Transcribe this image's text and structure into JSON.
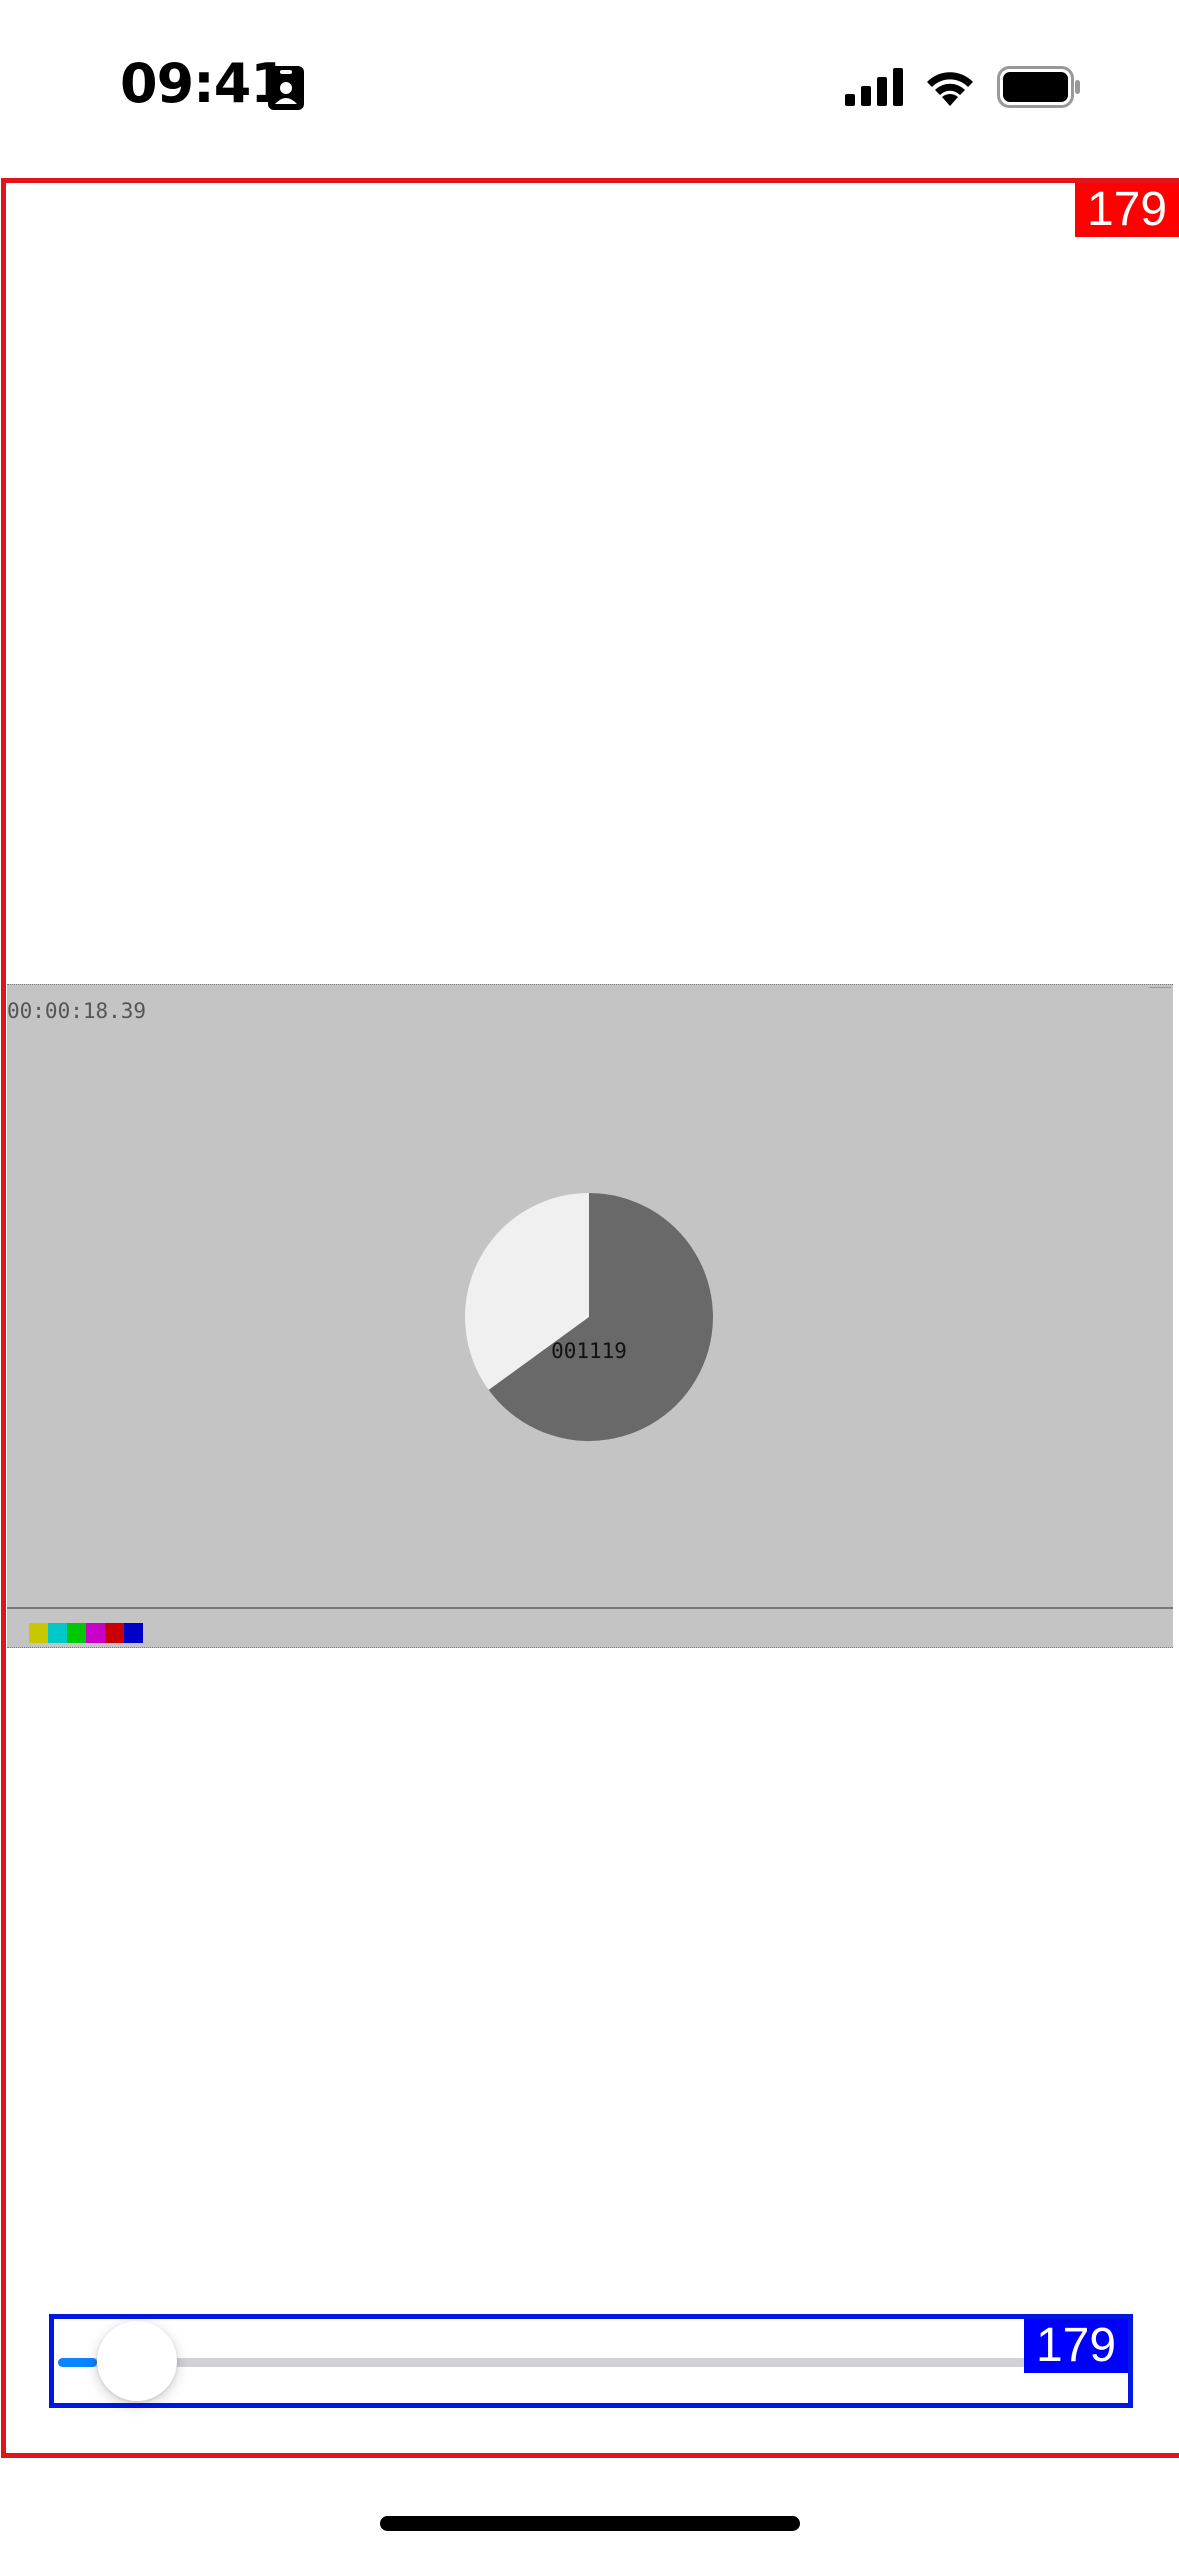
{
  "status_bar": {
    "time": "09:41",
    "icons": [
      "id-card-icon",
      "cellular-signal-icon",
      "wifi-icon",
      "battery-icon"
    ]
  },
  "outer_frame": {
    "badge": "179",
    "border_color": "#e3131b",
    "badge_color": "#ff0000"
  },
  "video": {
    "timecode": "00:00:18.39",
    "counter": "001119",
    "pie_fraction_dark": 0.65,
    "pie_dark_color": "#696969",
    "pie_light_color": "#f0f0f0",
    "background_color": "#c4c4c4",
    "color_bar_colors": [
      "#c8c800",
      "#00c8c8",
      "#00c800",
      "#c800c8",
      "#c80000",
      "#0000c8"
    ]
  },
  "slider": {
    "badge": "179",
    "value_fraction": 0.04,
    "border_color": "#0018e0",
    "fill_color": "#0a84ff"
  }
}
